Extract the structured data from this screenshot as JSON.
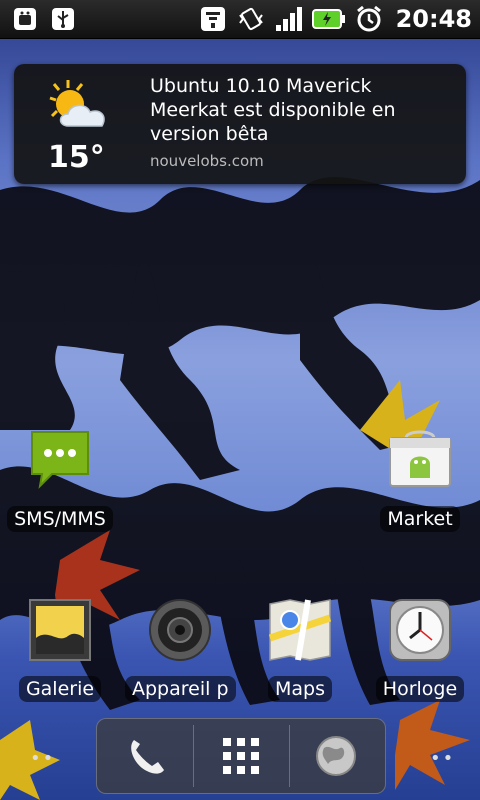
{
  "status_bar": {
    "time": "20:48",
    "left_icons": [
      "android-debug-icon",
      "usb-icon"
    ],
    "right_icons": [
      "wifi-icon",
      "vibrate-icon",
      "signal-icon",
      "battery-charging-icon",
      "alarm-icon"
    ]
  },
  "widget": {
    "temperature": "15°",
    "headline": "Ubuntu 10.10 Maverick Meerkat est disponible en version bêta",
    "source": "nouvelobs.com",
    "weather_icon": "partly-cloudy-icon"
  },
  "apps": {
    "sms": "SMS/MMS",
    "market": "Market",
    "gallery": "Galerie",
    "camera": "Appareil p",
    "maps": "Maps",
    "clock": "Horloge"
  },
  "dock": {
    "items": [
      "phone-icon",
      "app-drawer-icon",
      "browser-icon"
    ]
  },
  "colors": {
    "sms_green": "#7cb518",
    "status_bar": "#1a1a1a",
    "battery_green": "#5fcf2a"
  }
}
